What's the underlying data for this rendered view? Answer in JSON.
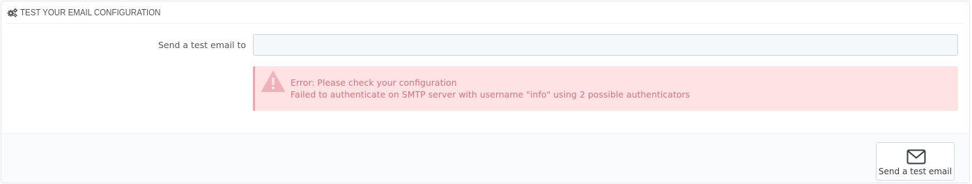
{
  "panel": {
    "heading_icon": "cogs-icon",
    "heading_title": "TEST YOUR EMAIL CONFIGURATION"
  },
  "form": {
    "label": "Send a test email to",
    "email_value": "",
    "email_placeholder": ""
  },
  "alert": {
    "icon": "warning-icon",
    "line1": "Error: Please check your configuration",
    "line2": "Failed to authenticate on SMTP server with username \"info\" using 2 possible authenticators"
  },
  "footer": {
    "send_button_icon": "envelope-icon",
    "send_button_label": "Send a test email"
  },
  "colors": {
    "alert_background": "#ffe2e4",
    "alert_text": "#d1727f",
    "input_background": "#f5f8f9"
  }
}
